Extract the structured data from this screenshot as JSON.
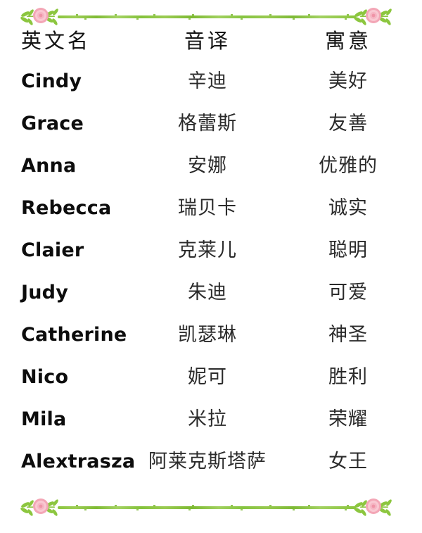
{
  "decor": {
    "rose_color": "#f3a6b6",
    "rose_center_color": "#f9ccd6",
    "leaf_color": "#8cc63f",
    "vine_color": "#8cc63f",
    "top_divider_name": "rose-vine-divider-top",
    "bottom_divider_name": "rose-vine-divider-bottom"
  },
  "table": {
    "headers": {
      "name": "英文名",
      "transliteration": "音译",
      "meaning": "寓意"
    },
    "rows": [
      {
        "name": "Cindy",
        "transliteration": "辛迪",
        "meaning": "美好"
      },
      {
        "name": "Grace",
        "transliteration": "格蕾斯",
        "meaning": "友善"
      },
      {
        "name": "Anna",
        "transliteration": "安娜",
        "meaning": "优雅的"
      },
      {
        "name": "Rebecca",
        "transliteration": "瑞贝卡",
        "meaning": "诚实"
      },
      {
        "name": "Claier",
        "transliteration": "克莱儿",
        "meaning": "聪明"
      },
      {
        "name": "Judy",
        "transliteration": "朱迪",
        "meaning": "可爱"
      },
      {
        "name": "Catherine",
        "transliteration": "凯瑟琳",
        "meaning": "神圣"
      },
      {
        "name": "Nico",
        "transliteration": "妮可",
        "meaning": "胜利"
      },
      {
        "name": "Mila",
        "transliteration": "米拉",
        "meaning": "荣耀"
      },
      {
        "name": "Alextrasza",
        "transliteration": "阿莱克斯塔萨",
        "meaning": "女王"
      }
    ]
  }
}
